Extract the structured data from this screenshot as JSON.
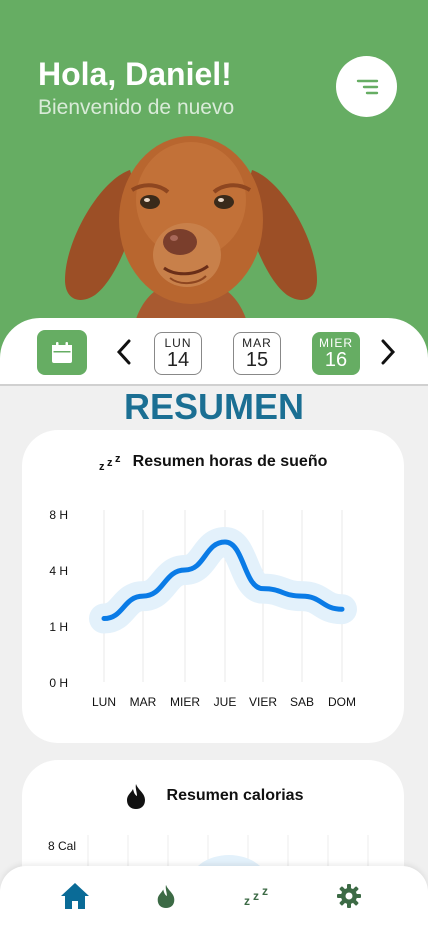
{
  "header": {
    "greeting": "Hola, Daniel!",
    "subtitle": "Bienvenido de nuevo",
    "menu_icon": "menu-lines-icon"
  },
  "date_strip": {
    "days": [
      {
        "name": "LUN",
        "num": "14",
        "selected": false
      },
      {
        "name": "MAR",
        "num": "15",
        "selected": false
      },
      {
        "name": "MIER",
        "num": "16",
        "selected": true
      }
    ]
  },
  "section_title": "RESUMEN",
  "sleep_card": {
    "icon": "zzz-icon",
    "title": "Resumen horas de sueño"
  },
  "calories_card": {
    "icon": "flame-icon",
    "title": "Resumen calorias"
  },
  "chart_data": [
    {
      "type": "line",
      "categories": [
        "LUN",
        "MAR",
        "MIER",
        "JUE",
        "VIER",
        "SAB",
        "DOM"
      ],
      "y_tick_labels": [
        "0 H",
        "1 H",
        "4 H",
        "8 H"
      ],
      "series": [
        {
          "values": [
            1.4,
            2.6,
            4.0,
            6.0,
            3.0,
            2.6,
            1.9
          ]
        }
      ],
      "grid": "vertical",
      "color": "#0a7be6"
    },
    {
      "type": "line",
      "y_tick_labels": [
        "8 Cal"
      ]
    }
  ],
  "bottom_nav": {
    "items": [
      "home-icon",
      "flame-icon",
      "zzz-icon",
      "gear-icon"
    ],
    "active_color": "#0a6b97",
    "inactive_color": "#3c6a45"
  },
  "colors": {
    "brand_green": "#66ad63",
    "title_blue": "#1b6f93"
  }
}
